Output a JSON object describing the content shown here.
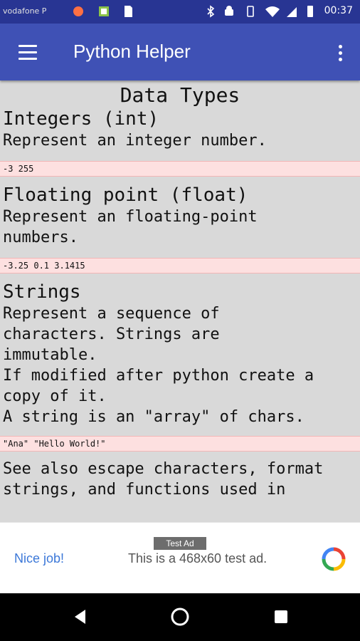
{
  "status_bar": {
    "carrier": "vodafone P",
    "time": "00:37"
  },
  "app_bar": {
    "title": "Python Helper",
    "menu_icon": "hamburger-menu-icon",
    "overflow_icon": "more-vert-icon"
  },
  "content": {
    "page_title": "Data Types",
    "sections": [
      {
        "heading": "Integers (int)",
        "description": "Represent an integer number.",
        "code": "-3 255"
      },
      {
        "heading": "Floating point (float)",
        "description": "Represent an floating-point\nnumbers.",
        "code": "-3.25 0.1 3.1415"
      },
      {
        "heading": "Strings",
        "description": "Represent a sequence of\ncharacters. Strings are\nimmutable.\nIf modified after python create a\ncopy of it.\nA string is an \"array\" of chars.",
        "code": "\"Ana\" \"Hello World!\""
      }
    ],
    "see_also": "See also escape characters, format\nstrings, and functions used in"
  },
  "ad": {
    "badge": "Test Ad",
    "headline": "Nice job!",
    "text": "This is a 468x60 test ad."
  },
  "colors": {
    "status_bar": "#283593",
    "app_bar": "#3f51b5",
    "content_bg": "#d9d9d9",
    "code_bg": "#fde0e0"
  }
}
